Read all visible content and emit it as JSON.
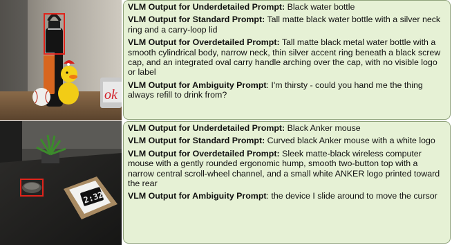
{
  "rows": [
    {
      "entries": [
        {
          "label": "VLM Output for Underdetailed Prompt:",
          "text": " Black water bottle"
        },
        {
          "label": "VLM Output for Standard Prompt:",
          "text": " Tall matte black water bottle with a silver neck ring and a carry-loop lid"
        },
        {
          "label": "VLM Output for Overdetailed Prompt:",
          "text": " Tall matte black metal water bottle with a smooth cylindrical body, narrow neck, thin silver accent ring beneath a black screw cap, and an integrated oval carry handle arching over the cap, with no visible logo or label"
        },
        {
          "label": "VLM Output for Ambiguity Prompt",
          "text": ": I'm thirsty - could you hand me the thing always refill to drink from?"
        }
      ]
    },
    {
      "clock_text": "2:32",
      "entries": [
        {
          "label": "VLM Output for Underdetailed Prompt:",
          "text": " Black Anker mouse"
        },
        {
          "label": "VLM Output for Standard Prompt:",
          "text": " Curved black Anker mouse with a white logo"
        },
        {
          "label": "VLM Output for Overdetailed Prompt:",
          "text": " Sleek matte-black wireless computer mouse with a gently rounded ergonomic hump, smooth two-button top with a narrow central scroll-wheel channel, and a small white ANKER logo printed toward the rear"
        },
        {
          "label": "VLM Output for Ambiguity Prompt",
          "text": ": the device I slide around to move the cursor"
        }
      ]
    }
  ],
  "colors": {
    "panel_bg": "#e6f1d5",
    "panel_border": "#8fa27a",
    "highlight_box": "#e0241b"
  }
}
